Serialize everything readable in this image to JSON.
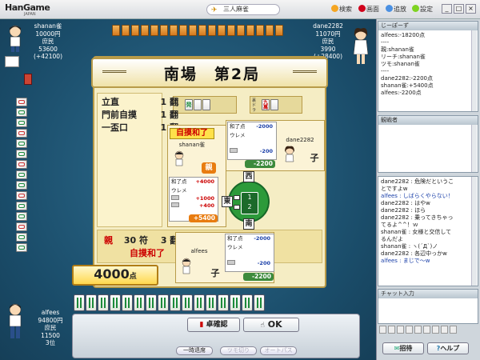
{
  "window": {
    "logo": "HanGame",
    "logo_sub": "JAPAN",
    "title": "三人麻雀",
    "toolbar": [
      "検索",
      "画面",
      "追放",
      "設定"
    ],
    "controls": [
      "_",
      "□",
      "×"
    ]
  },
  "players": {
    "top_left": {
      "name": "shanan雀",
      "money": "10000円",
      "rank": "庶民",
      "score": "53600",
      "delta": "(+42100)"
    },
    "top_right": {
      "name": "dane2282",
      "money": "11070円",
      "rank": "庶民",
      "score": "3990",
      "delta": "(+28400)"
    },
    "bottom": {
      "name": "alfees",
      "money": "94800円",
      "rank": "庶民",
      "score": "11500",
      "place": "3位"
    }
  },
  "result": {
    "round_title": "南場　第2局",
    "dora_label": "ドラ",
    "dora_tile": "発",
    "ura_label": "裏ドラ",
    "ura_tile": "九萬",
    "yaku": [
      {
        "name": "立直",
        "han": "1 翻"
      },
      {
        "name": "門前自摸",
        "han": "1 翻"
      },
      {
        "name": "一盃口",
        "han": "1 翻"
      }
    ],
    "dealer_tag": "親",
    "fu": "30 符",
    "han_total": "3 翻",
    "win_type": "自摸和了",
    "total": "4000",
    "total_unit": "点"
  },
  "winner_card": {
    "tag": "自摸和了",
    "name": "shanan雀",
    "seat": "親",
    "rows": [
      {
        "label": "和了点",
        "value": "+4000"
      },
      {
        "label": "ウレメ",
        "value": ""
      },
      {
        "label": "",
        "value": "+1000"
      },
      {
        "label": "",
        "value": "+400"
      }
    ],
    "total": "+5400"
  },
  "dane_card": {
    "name": "dane2282",
    "seat": "子",
    "rows": [
      {
        "label": "和了点",
        "value": "-2000"
      },
      {
        "label": "ウレメ",
        "value": ""
      },
      {
        "label": "",
        "value": "-200"
      }
    ],
    "total": "-2200"
  },
  "alfees_card": {
    "name": "alfees",
    "seat": "子",
    "rows": [
      {
        "label": "和了点",
        "value": "-2000"
      },
      {
        "label": "ウレメ",
        "value": ""
      },
      {
        "label": "",
        "value": "-200"
      }
    ],
    "total": "-2200"
  },
  "compass": {
    "north": "西",
    "west": "東",
    "south": "南",
    "center": "1\n2"
  },
  "buttons": {
    "confirm_table": "卓確認",
    "ok": "OK",
    "leave": "一時退席",
    "tsumogiri": "ツモ切り",
    "auto_pass": "オートパス"
  },
  "sidebar": {
    "log_title": "じーぽーず",
    "log": [
      "alfees:-18200点",
      "----",
      "親:shanan雀",
      "リーチ:shanan雀",
      "ツモ:shanan雀",
      "----",
      "dane2282:-2200点",
      "shanan雀:+5400点",
      "alfees:-2200点"
    ],
    "spectator_title": "観戦者",
    "chat": [
      "dane2282 : 危険だというこ",
      "とですよw",
      "alfees : しばらくやらない！",
      "dane2282 : はやw",
      "dane2282 : ほら",
      "dane2282 : 乗ってきちゃっ",
      "てるよ^^！ｗ",
      "shanan雀 : 女様と交信して",
      "るんだよ",
      "shanan雀 : ヽ(´Д`)ノ",
      "dane2282 : 各辺中っかw",
      "alfees : まじで〜w"
    ],
    "chat_input_title": "チャット入力",
    "invite": "招待",
    "help": "ヘルプ"
  },
  "colors": {
    "accent": "#c00000",
    "table": "#1d4f6b",
    "panel": "#f5edc4",
    "green": "#2c9a3a"
  }
}
